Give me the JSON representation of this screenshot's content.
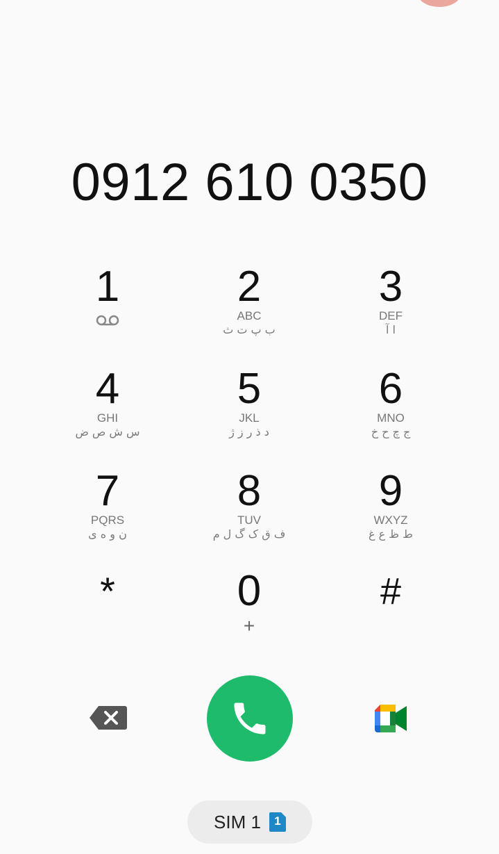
{
  "dialer": {
    "number": "0912 610 0350"
  },
  "keypad": {
    "keys": [
      {
        "digit": "1",
        "letters": "",
        "alt": "",
        "icon": "voicemail-icon"
      },
      {
        "digit": "2",
        "letters": "ABC",
        "alt": "ب پ ت ث"
      },
      {
        "digit": "3",
        "letters": "DEF",
        "alt": "ا آ"
      },
      {
        "digit": "4",
        "letters": "GHI",
        "alt": "س ش ص ض"
      },
      {
        "digit": "5",
        "letters": "JKL",
        "alt": "د ذ ر ز ژ"
      },
      {
        "digit": "6",
        "letters": "MNO",
        "alt": "ج چ ح خ"
      },
      {
        "digit": "7",
        "letters": "PQRS",
        "alt": "ن و ه ی"
      },
      {
        "digit": "8",
        "letters": "TUV",
        "alt": "ف ق ک گ ل م"
      },
      {
        "digit": "9",
        "letters": "WXYZ",
        "alt": "ط ظ ع غ"
      },
      {
        "digit": "*",
        "letters": "",
        "alt": ""
      },
      {
        "digit": "0",
        "letters": "+",
        "alt": ""
      },
      {
        "digit": "#",
        "letters": "",
        "alt": ""
      }
    ]
  },
  "actions": {
    "backspace_icon": "backspace-icon",
    "call_icon": "phone-icon",
    "video_icon": "video-call-icon"
  },
  "sim": {
    "label": "SIM 1",
    "badge": "1"
  },
  "colors": {
    "call_green": "#1fbb6c",
    "sim_blue": "#1e88c7",
    "background": "#fafafa"
  }
}
